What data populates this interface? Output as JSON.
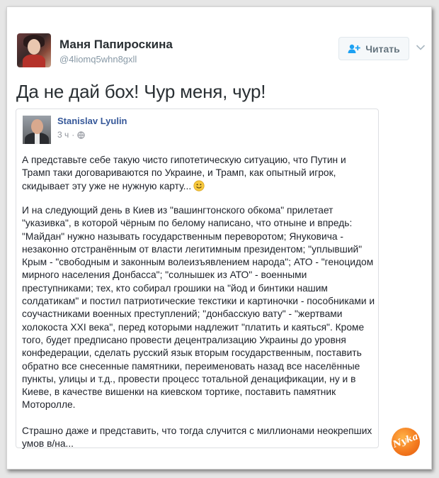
{
  "tweet": {
    "author_name": "Маня Папироскина",
    "author_handle": "@4liomq5whn8gxll",
    "follow_label": "Читать",
    "text": "Да не дай бох! Чур меня, чур!"
  },
  "embedded_post": {
    "author": "Stanislav Lyulin",
    "time": "3 ч",
    "paragraphs": [
      "А представьте себе такую чисто гипотетическую ситуацию, что Путин и Трамп таки договариваются по Украине, и Трамп, как опытный игрок, скидывает эту уже не нужную карту...",
      "И на следующий день в Киев из \"вашингтонского обкома\" прилетает \"указивка\", в которой чёрным по белому написано, что отныне и впредь: \"Майдан\" нужно называть государственным переворотом; Януковича - незаконно отстранённым от власти легитимным президентом; \"уплывший\" Крым - \"свободным и законным волеизъявлением народа\"; АТО - \"геноцидом мирного населения Донбасса\"; \"солнышек из АТО\" - военными преступниками; тех, кто собирал грошики на \"йод и бинтики нашим солдатикам\" и постил патриотические текстики и картиночки - пособниками и соучастниками военных преступлений; \"донбасскую вату\" - \"жертвами холокоста XXI века\", перед которыми надлежит \"платить и каяться\". Кроме того, будет предписано провести децентрализацию Украины до уровня конфедерации, сделать русский язык вторым государственным, поставить обратно все снесенные памятники, переименовать назад все населённые пункты, улицы и т.д., провести процесс тотальной денацификации, ну и в Киеве, в качестве вишенки на киевском тортике, поставить памятник Моторолле.",
      "Страшно даже и представить, что тогда случится с миллионами неокрепших умов в/на..."
    ]
  },
  "watermark_text": "Nyka",
  "icons": {
    "follow": "add-user-icon",
    "menu": "chevron-down-icon",
    "privacy": "globe-icon",
    "emoji": "smiley-icon"
  },
  "colors": {
    "fb_link": "#365899",
    "twitter_text": "#292f33",
    "handle": "#8899a6",
    "follow_icon": "#1da1f2"
  }
}
